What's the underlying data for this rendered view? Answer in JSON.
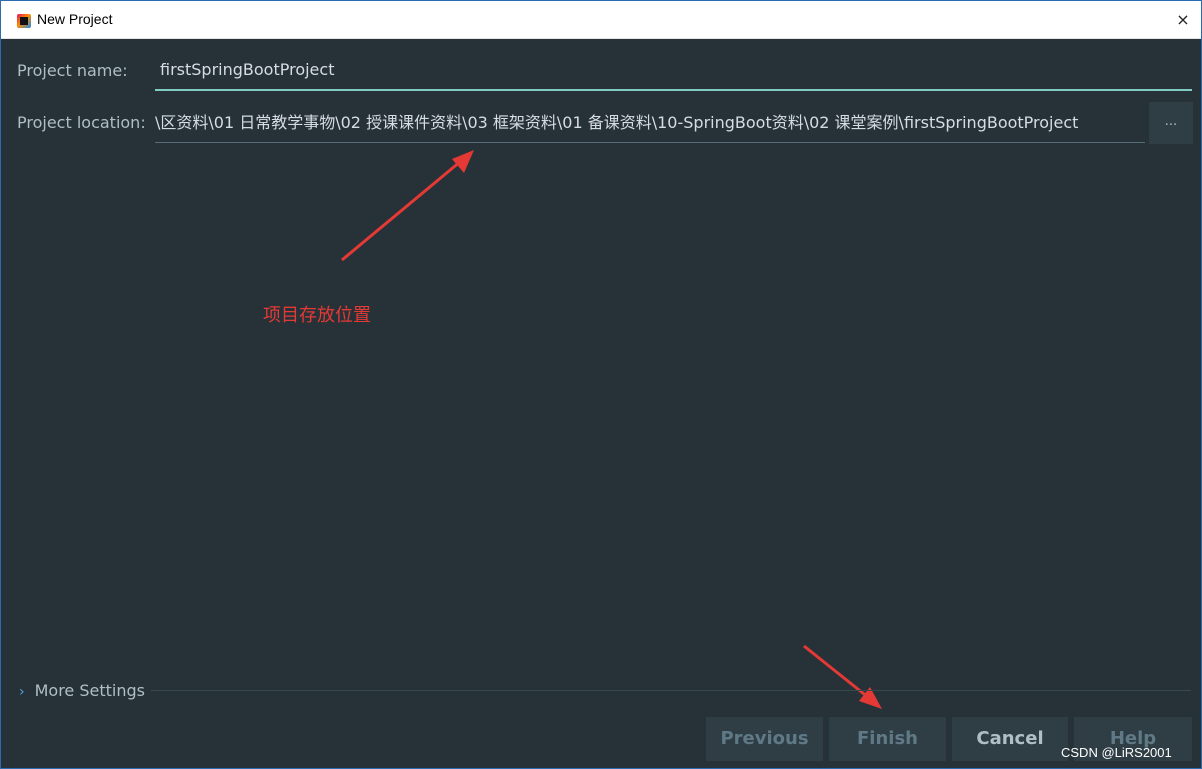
{
  "window": {
    "title": "New Project",
    "close_glyph": "×"
  },
  "form": {
    "name_label": "Project name:",
    "name_value": "firstSpringBootProject",
    "location_label": "Project location:",
    "location_value": "\\区资料\\01 日常教学事物\\02 授课课件资料\\03 框架资料\\01 备课资料\\10-SpringBoot资料\\02 课堂案例\\firstSpringBootProject",
    "browse_label": "..."
  },
  "annotation": {
    "text": "项目存放位置",
    "color": "#e53935"
  },
  "more_settings": {
    "chevron": "›",
    "label": "More Settings"
  },
  "buttons": {
    "previous": "Previous",
    "finish": "Finish",
    "cancel": "Cancel",
    "help": "Help"
  },
  "watermark": "CSDN @LiRS2001",
  "colors": {
    "background": "#263238",
    "accent_underline": "#80cbc4",
    "annotation": "#e53935"
  }
}
